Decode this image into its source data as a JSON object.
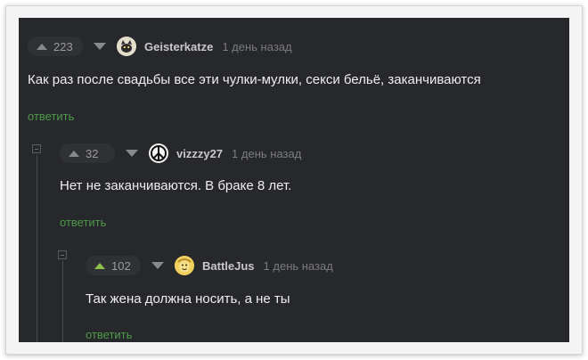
{
  "comments": [
    {
      "votes": "223",
      "username": "Geisterkatze",
      "time": "1 день назад",
      "text": "Как раз после свадьбы все эти чулки-мулки, секси бельё, заканчиваются",
      "reply_label": "ответить",
      "avatar_icon": "cat-avatar-icon"
    },
    {
      "votes": "32",
      "username": "vizzzy27",
      "time": "1 день назад",
      "text": "Нет не заканчиваются. В браке 8 лет.",
      "reply_label": "ответить",
      "avatar_icon": "peace-sign-avatar-icon"
    },
    {
      "votes": "102",
      "username": "BattleJus",
      "time": "1 день назад",
      "text": "Так жена должна носить, а не ты",
      "reply_label": "ответить",
      "avatar_icon": "yellow-cartoon-avatar-icon",
      "vote_state": "upvoted"
    }
  ],
  "colors": {
    "background": "#27282b",
    "reply_link": "#4e9a4a",
    "upvote_active": "#8bc34a"
  }
}
